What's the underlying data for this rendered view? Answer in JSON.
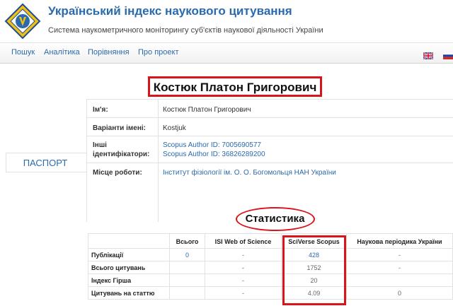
{
  "header": {
    "title": "Український індекс наукового цитування",
    "subtitle": "Система наукометричного моніторингу суб'єктів наукової діяльності України"
  },
  "nav": {
    "items": [
      "Пошук",
      "Аналітика",
      "Порівняння",
      "Про проект"
    ],
    "flags": [
      "uk-flag-icon",
      "ru-flag-icon"
    ]
  },
  "person": {
    "name": "Костюк Платон Григорович"
  },
  "passport": {
    "label": "ПАСПОРТ"
  },
  "info": {
    "name_label": "Ім'я:",
    "name_value": "Костюк Платон Григорович",
    "variants_label": "Варіанти імені:",
    "variants_value": "Kostjuk",
    "ids_label_1": "Інші",
    "ids_label_2": "ідентифікатори:",
    "ids_value_1": "Scopus Author ID: 7005690577",
    "ids_value_2": "Scopus Author ID: 36826289200",
    "work_label": "Місце роботи:",
    "work_value": "Інститут фізіології ім. О. О. Богомольця НАН України"
  },
  "stats": {
    "heading": "Статистика",
    "columns": [
      "Всього",
      "ISI Web of Science",
      "SciVerse Scopus",
      "Наукова періодика України"
    ],
    "rows": [
      {
        "label": "Публікації",
        "values": [
          "0",
          "-",
          "428",
          "-"
        ]
      },
      {
        "label": "Всього цитувань",
        "values": [
          "",
          "-",
          "1752",
          "-"
        ]
      },
      {
        "label": "Індекс Гірша",
        "values": [
          "",
          "-",
          "20",
          ""
        ]
      },
      {
        "label": "Цитувань на статтю",
        "values": [
          "",
          "-",
          "4.09",
          "0"
        ]
      }
    ]
  },
  "colors": {
    "accent": "#2a6aad",
    "highlight": "#d9141a"
  }
}
